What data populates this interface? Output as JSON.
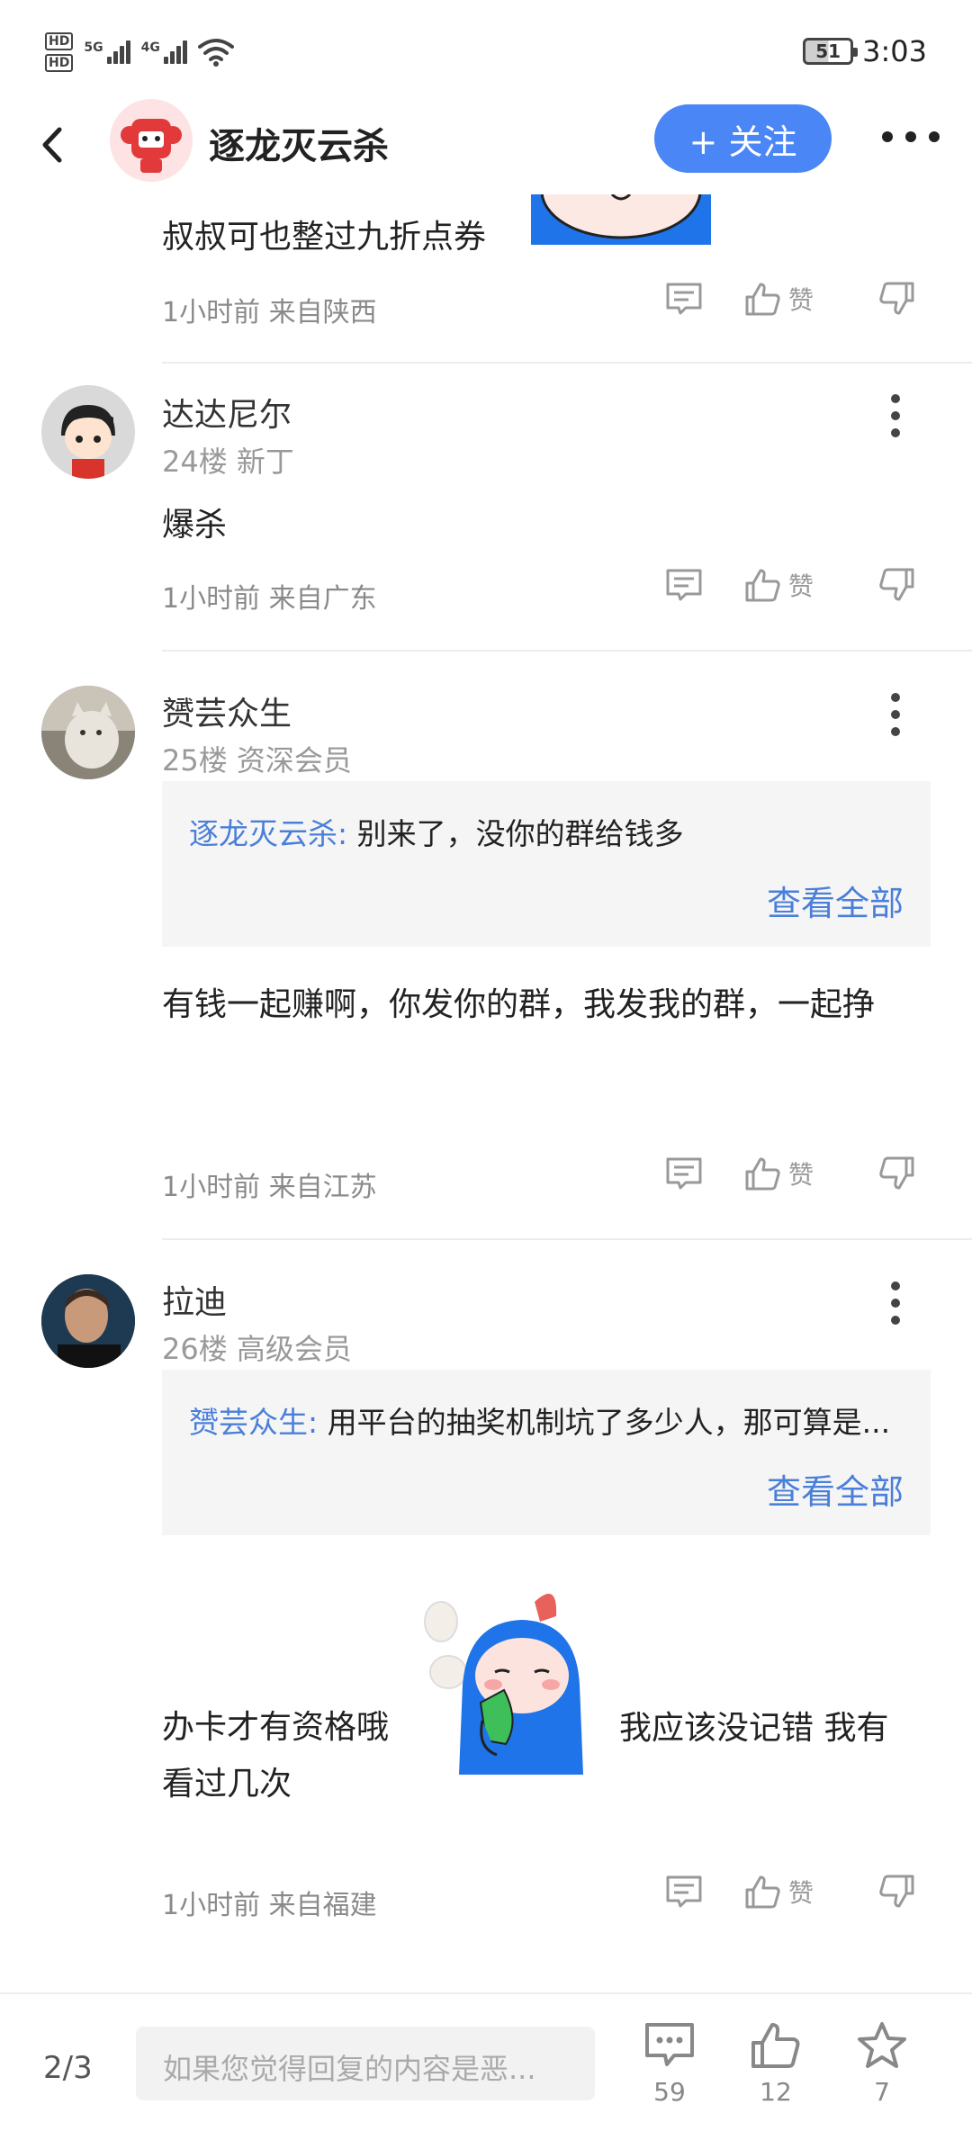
{
  "status_bar": {
    "hd_labels": [
      "HD",
      "HD"
    ],
    "network1": "5G",
    "network2": "4G",
    "battery": "51",
    "time": "3:03"
  },
  "header": {
    "title": "逐龙灭云杀",
    "follow_label": "+ 关注"
  },
  "top_post": {
    "text": "叔叔可也整过九折点券",
    "meta": "1小时前 来自陕西"
  },
  "actions": {
    "like_label": "赞"
  },
  "comments": [
    {
      "name": "达达尼尔",
      "floor": "24楼 新丁",
      "text": "爆杀",
      "meta": "1小时前 来自广东"
    },
    {
      "name": "赟芸众生",
      "floor": "25楼 资深会员",
      "quote_author": "逐龙灭云杀:",
      "quote_text": " 别来了，没你的群给钱多",
      "quote_more": "查看全部",
      "text": "有钱一起赚啊，你发你的群，我发我的群，一起挣",
      "meta": "1小时前 来自江苏"
    },
    {
      "name": "拉迪",
      "floor": "26楼 高级会员",
      "quote_author": "赟芸众生:",
      "quote_text": " 用平台的抽奖机制坑了多少人，那可算是...",
      "quote_more": "查看全部",
      "text_before": "办卡才有资格哦",
      "text_after": "我应该没记错 我有看过几次",
      "meta": "1小时前 来自福建"
    }
  ],
  "bottom_bar": {
    "page_indicator": "2/3",
    "reply_placeholder": "如果您觉得回复的内容是恶...",
    "comment_count": "59",
    "like_count": "12",
    "star_count": "7"
  },
  "colors": {
    "accent": "#4a86f5",
    "link": "#4a7fd9",
    "quote_bg": "#f5f5f5",
    "muted": "#8a8a8a"
  },
  "icons": [
    "back-icon",
    "more-icon",
    "comment-icon",
    "thumbs-up-icon",
    "thumbs-down-icon",
    "star-icon",
    "kebab-icon"
  ]
}
